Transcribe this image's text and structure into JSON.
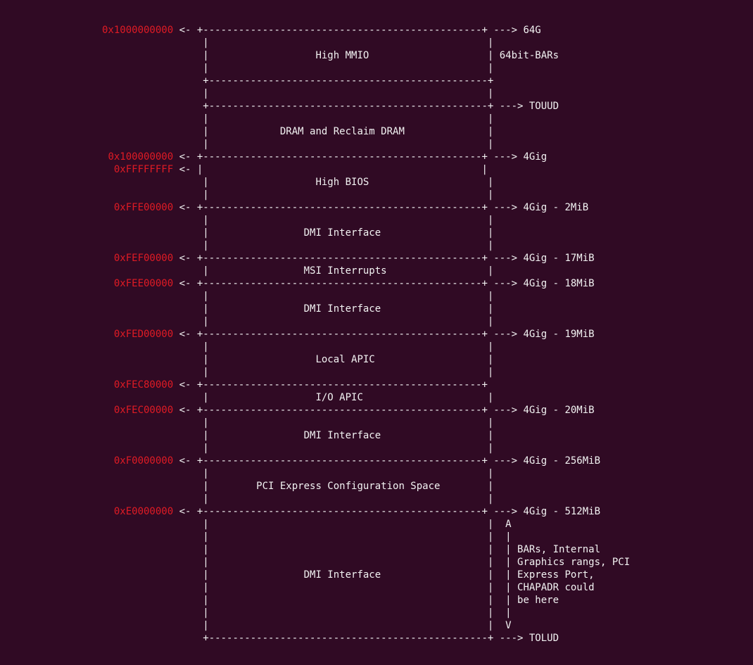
{
  "terminal": {
    "colors": {
      "background": "#300a24",
      "text": "#f2f2f2",
      "address": "#e01b24"
    },
    "lines": [
      {
        "addr": "0x1000000000",
        "text": " <- +-----------------------------------------------+ ---> 64G"
      },
      {
        "addr": "",
        "text": "     |                                               |"
      },
      {
        "addr": "",
        "text": "     |                  High MMIO                    | 64bit-BARs"
      },
      {
        "addr": "",
        "text": "     |                                               |"
      },
      {
        "addr": "",
        "text": "     +-----------------------------------------------+"
      },
      {
        "addr": "",
        "text": "     |                                               |"
      },
      {
        "addr": "",
        "text": "     +-----------------------------------------------+ ---> TOUUD"
      },
      {
        "addr": "",
        "text": "     |                                               |"
      },
      {
        "addr": "",
        "text": "     |            DRAM and Reclaim DRAM              |"
      },
      {
        "addr": "",
        "text": "     |                                               |"
      },
      {
        "addr": "0x100000000",
        "text": " <- +-----------------------------------------------+ ---> 4Gig"
      },
      {
        "addr": "0xFFFFFFFF",
        "text": " <- |                                               |"
      },
      {
        "addr": "",
        "text": "     |                  High BIOS                    |"
      },
      {
        "addr": "",
        "text": "     |                                               |"
      },
      {
        "addr": "0xFFE00000",
        "text": " <- +-----------------------------------------------+ ---> 4Gig - 2MiB"
      },
      {
        "addr": "",
        "text": "     |                                               |"
      },
      {
        "addr": "",
        "text": "     |                DMI Interface                  |"
      },
      {
        "addr": "",
        "text": "     |                                               |"
      },
      {
        "addr": "0xFEF00000",
        "text": " <- +-----------------------------------------------+ ---> 4Gig - 17MiB"
      },
      {
        "addr": "",
        "text": "     |                MSI Interrupts                 |"
      },
      {
        "addr": "0xFEE00000",
        "text": " <- +-----------------------------------------------+ ---> 4Gig - 18MiB"
      },
      {
        "addr": "",
        "text": "     |                                               |"
      },
      {
        "addr": "",
        "text": "     |                DMI Interface                  |"
      },
      {
        "addr": "",
        "text": "     |                                               |"
      },
      {
        "addr": "0xFED00000",
        "text": " <- +-----------------------------------------------+ ---> 4Gig - 19MiB"
      },
      {
        "addr": "",
        "text": "     |                                               |"
      },
      {
        "addr": "",
        "text": "     |                  Local APIC                   |"
      },
      {
        "addr": "",
        "text": "     |                                               |"
      },
      {
        "addr": "0xFEC80000",
        "text": " <- +-----------------------------------------------+"
      },
      {
        "addr": "",
        "text": "     |                  I/O APIC                     |"
      },
      {
        "addr": "0xFEC00000",
        "text": " <- +-----------------------------------------------+ ---> 4Gig - 20MiB"
      },
      {
        "addr": "",
        "text": "     |                                               |"
      },
      {
        "addr": "",
        "text": "     |                DMI Interface                  |"
      },
      {
        "addr": "",
        "text": "     |                                               |"
      },
      {
        "addr": "0xF0000000",
        "text": " <- +-----------------------------------------------+ ---> 4Gig - 256MiB"
      },
      {
        "addr": "",
        "text": "     |                                               |"
      },
      {
        "addr": "",
        "text": "     |        PCI Express Configuration Space        |"
      },
      {
        "addr": "",
        "text": "     |                                               |"
      },
      {
        "addr": "0xE0000000",
        "text": " <- +-----------------------------------------------+ ---> 4Gig - 512MiB"
      },
      {
        "addr": "",
        "text": "     |                                               |  A"
      },
      {
        "addr": "",
        "text": "     |                                               |  |"
      },
      {
        "addr": "",
        "text": "     |                                               |  | BARs, Internal"
      },
      {
        "addr": "",
        "text": "     |                                               |  | Graphics rangs, PCI"
      },
      {
        "addr": "",
        "text": "     |                DMI Interface                  |  | Express Port,"
      },
      {
        "addr": "",
        "text": "     |                                               |  | CHAPADR could"
      },
      {
        "addr": "",
        "text": "     |                                               |  | be here"
      },
      {
        "addr": "",
        "text": "     |                                               |  |"
      },
      {
        "addr": "",
        "text": "     |                                               |  V"
      },
      {
        "addr": "",
        "text": "     +-----------------------------------------------+ ---> TOLUD"
      }
    ]
  }
}
